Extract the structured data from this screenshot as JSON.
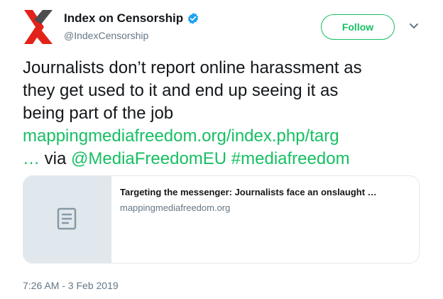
{
  "author": {
    "name": "Index on Censorship",
    "handle": "@IndexCensorship"
  },
  "header": {
    "follow_label": "Follow"
  },
  "tweet": {
    "line1": "Journalists don’t report online harassment as",
    "line2": "they get used to it and end up seeing it as",
    "line3": "being part of the job",
    "url_part1": "mappingmediafreedom.org/index.php/targ",
    "url_part2": "…",
    "via": " via ",
    "mention": "@MediaFreedomEU",
    "space": " ",
    "hashtag": "#mediafreedom"
  },
  "card": {
    "title": "Targeting the messenger: Journalists face an onslaught …",
    "domain": "mappingmediafreedom.org"
  },
  "timestamp": "7:26 AM - 3 Feb 2019",
  "colors": {
    "accent": "#17bf63",
    "verified": "#1da1f2",
    "secondary_text": "#657786",
    "logo_red": "#e2231a",
    "logo_gray": "#4d4d4d"
  },
  "icons": {
    "avatar": "index-on-censorship-logo",
    "verified": "verified-badge-icon",
    "caret": "chevron-down-icon",
    "card_thumbnail": "document-icon"
  }
}
